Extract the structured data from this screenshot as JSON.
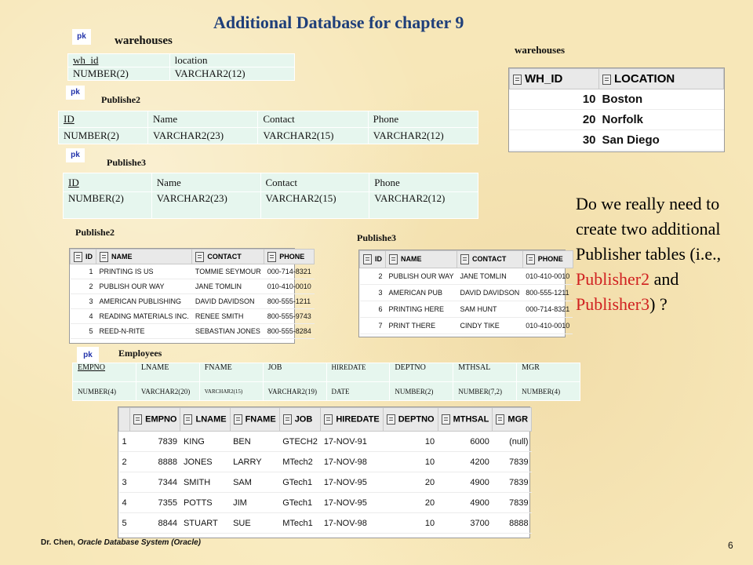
{
  "title": "Additional Database for chapter 9",
  "pk_label": "pk",
  "warehouses_schema": {
    "label": "warehouses",
    "headers": [
      "wh_id",
      "location"
    ],
    "types": [
      "NUMBER(2)",
      "VARCHAR2(12)"
    ]
  },
  "publishe2_schema": {
    "label": "Publishe2",
    "headers": [
      "ID",
      "Name",
      "Contact",
      "Phone"
    ],
    "types": [
      "NUMBER(2)",
      "VARCHAR2(23)",
      "VARCHAR2(15)",
      "VARCHAR2(12)"
    ]
  },
  "publishe3_schema": {
    "label": "Publishe3",
    "headers": [
      "ID",
      "Name",
      "Contact",
      "Phone"
    ],
    "types": [
      "NUMBER(2)",
      "VARCHAR2(23)",
      "VARCHAR2(15)",
      "VARCHAR2(12)"
    ]
  },
  "employees_schema": {
    "label": "Employees",
    "headers": [
      "EMPNO",
      "LNAME",
      "FNAME",
      "JOB",
      "HIREDATE",
      "DEPTNO",
      "MTHSAL",
      "MGR"
    ],
    "types": [
      "NUMBER(4)",
      "VARCHAR2(20)",
      "VARCHAR2(15)",
      "VARCHAR2(19)",
      "DATE",
      "NUMBER(2)",
      "NUMBER(7,2)",
      "NUMBER(4)"
    ]
  },
  "warehouses_data": {
    "label": "warehouses",
    "headers": [
      "WH_ID",
      "LOCATION"
    ],
    "rows": [
      [
        "10",
        "Boston"
      ],
      [
        "20",
        "Norfolk"
      ],
      [
        "30",
        "San Diego"
      ]
    ]
  },
  "publishe2_data": {
    "label": "Publishe2",
    "headers": [
      "ID",
      "NAME",
      "CONTACT",
      "PHONE"
    ],
    "rows": [
      [
        "1",
        "PRINTING IS US",
        "TOMMIE SEYMOUR",
        "000-714-8321"
      ],
      [
        "2",
        "PUBLISH OUR WAY",
        "JANE TOMLIN",
        "010-410-0010"
      ],
      [
        "3",
        "AMERICAN PUBLISHING",
        "DAVID DAVIDSON",
        "800-555-1211"
      ],
      [
        "4",
        "READING MATERIALS INC.",
        "RENEE SMITH",
        "800-555-9743"
      ],
      [
        "5",
        "REED-N-RITE",
        "SEBASTIAN JONES",
        "800-555-8284"
      ]
    ]
  },
  "publishe3_data": {
    "label": "Publishe3",
    "headers": [
      "ID",
      "NAME",
      "CONTACT",
      "PHONE"
    ],
    "rows": [
      [
        "2",
        "PUBLISH OUR WAY",
        "JANE TOMLIN",
        "010-410-0010"
      ],
      [
        "3",
        "AMERICAN PUB",
        "DAVID DAVIDSON",
        "800-555-1211"
      ],
      [
        "6",
        "PRINTING HERE",
        "SAM HUNT",
        "000-714-8321"
      ],
      [
        "7",
        "PRINT THERE",
        "CINDY TIKE",
        "010-410-0010"
      ]
    ]
  },
  "employees_data": {
    "headers": [
      "EMPNO",
      "LNAME",
      "FNAME",
      "JOB",
      "HIREDATE",
      "DEPTNO",
      "MTHSAL",
      "MGR"
    ],
    "rows": [
      [
        "1",
        "7839",
        "KING",
        "BEN",
        "GTECH2",
        "17-NOV-91",
        "10",
        "6000",
        "(null)"
      ],
      [
        "2",
        "8888",
        "JONES",
        "LARRY",
        "MTech2",
        "17-NOV-98",
        "10",
        "4200",
        "7839"
      ],
      [
        "3",
        "7344",
        "SMITH",
        "SAM",
        "GTech1",
        "17-NOV-95",
        "20",
        "4900",
        "7839"
      ],
      [
        "4",
        "7355",
        "POTTS",
        "JIM",
        "GTech1",
        "17-NOV-95",
        "20",
        "4900",
        "7839"
      ],
      [
        "5",
        "8844",
        "STUART",
        "SUE",
        "MTech1",
        "17-NOV-98",
        "10",
        "3700",
        "8888"
      ]
    ]
  },
  "question": {
    "part1": "Do we really need to create two additional Publisher tables (i.e., ",
    "red1": "Publisher2",
    "part2": " and ",
    "red2": "Publisher3",
    "part3": ") ?"
  },
  "footer": {
    "author": "Dr. Chen, ",
    "course": "Oracle Database System (Oracle)",
    "page": "6"
  }
}
